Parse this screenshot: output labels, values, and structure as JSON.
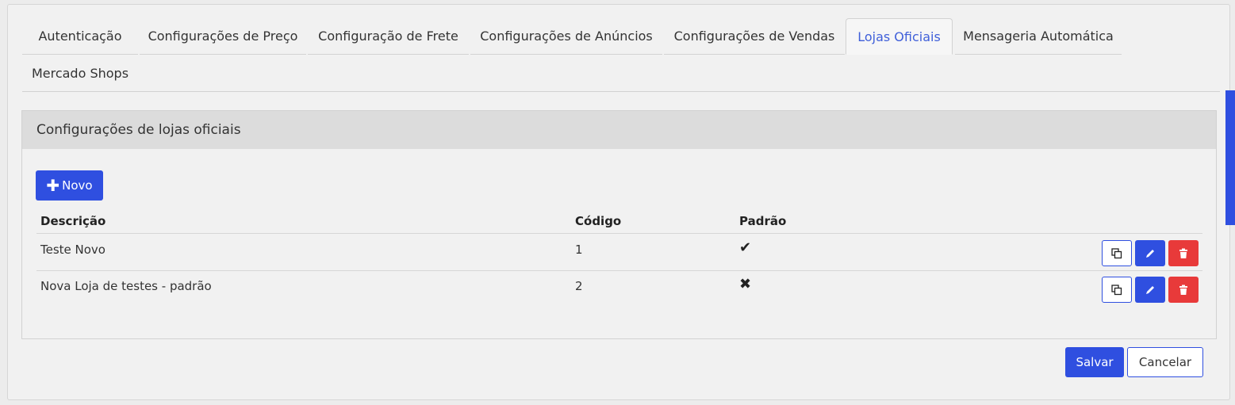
{
  "tabs": [
    {
      "label": "Autenticação",
      "active": false
    },
    {
      "label": "Configurações de Preço",
      "active": false
    },
    {
      "label": "Configuração de Frete",
      "active": false
    },
    {
      "label": "Configurações de Anúncios",
      "active": false
    },
    {
      "label": "Configurações de Vendas",
      "active": false
    },
    {
      "label": "Lojas Oficiais",
      "active": true
    },
    {
      "label": "Mensageria Automática",
      "active": false
    },
    {
      "label": "Mercado Shops",
      "active": false
    }
  ],
  "panel": {
    "title": "Configurações de lojas oficiais",
    "new_button": {
      "icon": "plus-icon",
      "label": "Novo"
    }
  },
  "table": {
    "headers": [
      "Descrição",
      "Código",
      "Padrão"
    ],
    "rows": [
      {
        "descricao": "Teste Novo",
        "codigo": "1",
        "padrao": true,
        "padrao_icon": "check-icon"
      },
      {
        "descricao": "Nova Loja de testes - padrão",
        "codigo": "2",
        "padrao": false,
        "padrao_icon": "x-icon"
      }
    ],
    "row_actions": [
      "copy-icon",
      "edit-icon",
      "trash-icon"
    ]
  },
  "footer": {
    "save_label": "Salvar",
    "cancel_label": "Cancelar"
  },
  "colors": {
    "accent": "#2f4fe0",
    "danger": "#e83a3a",
    "active_tab_text": "#3f5fd9"
  }
}
